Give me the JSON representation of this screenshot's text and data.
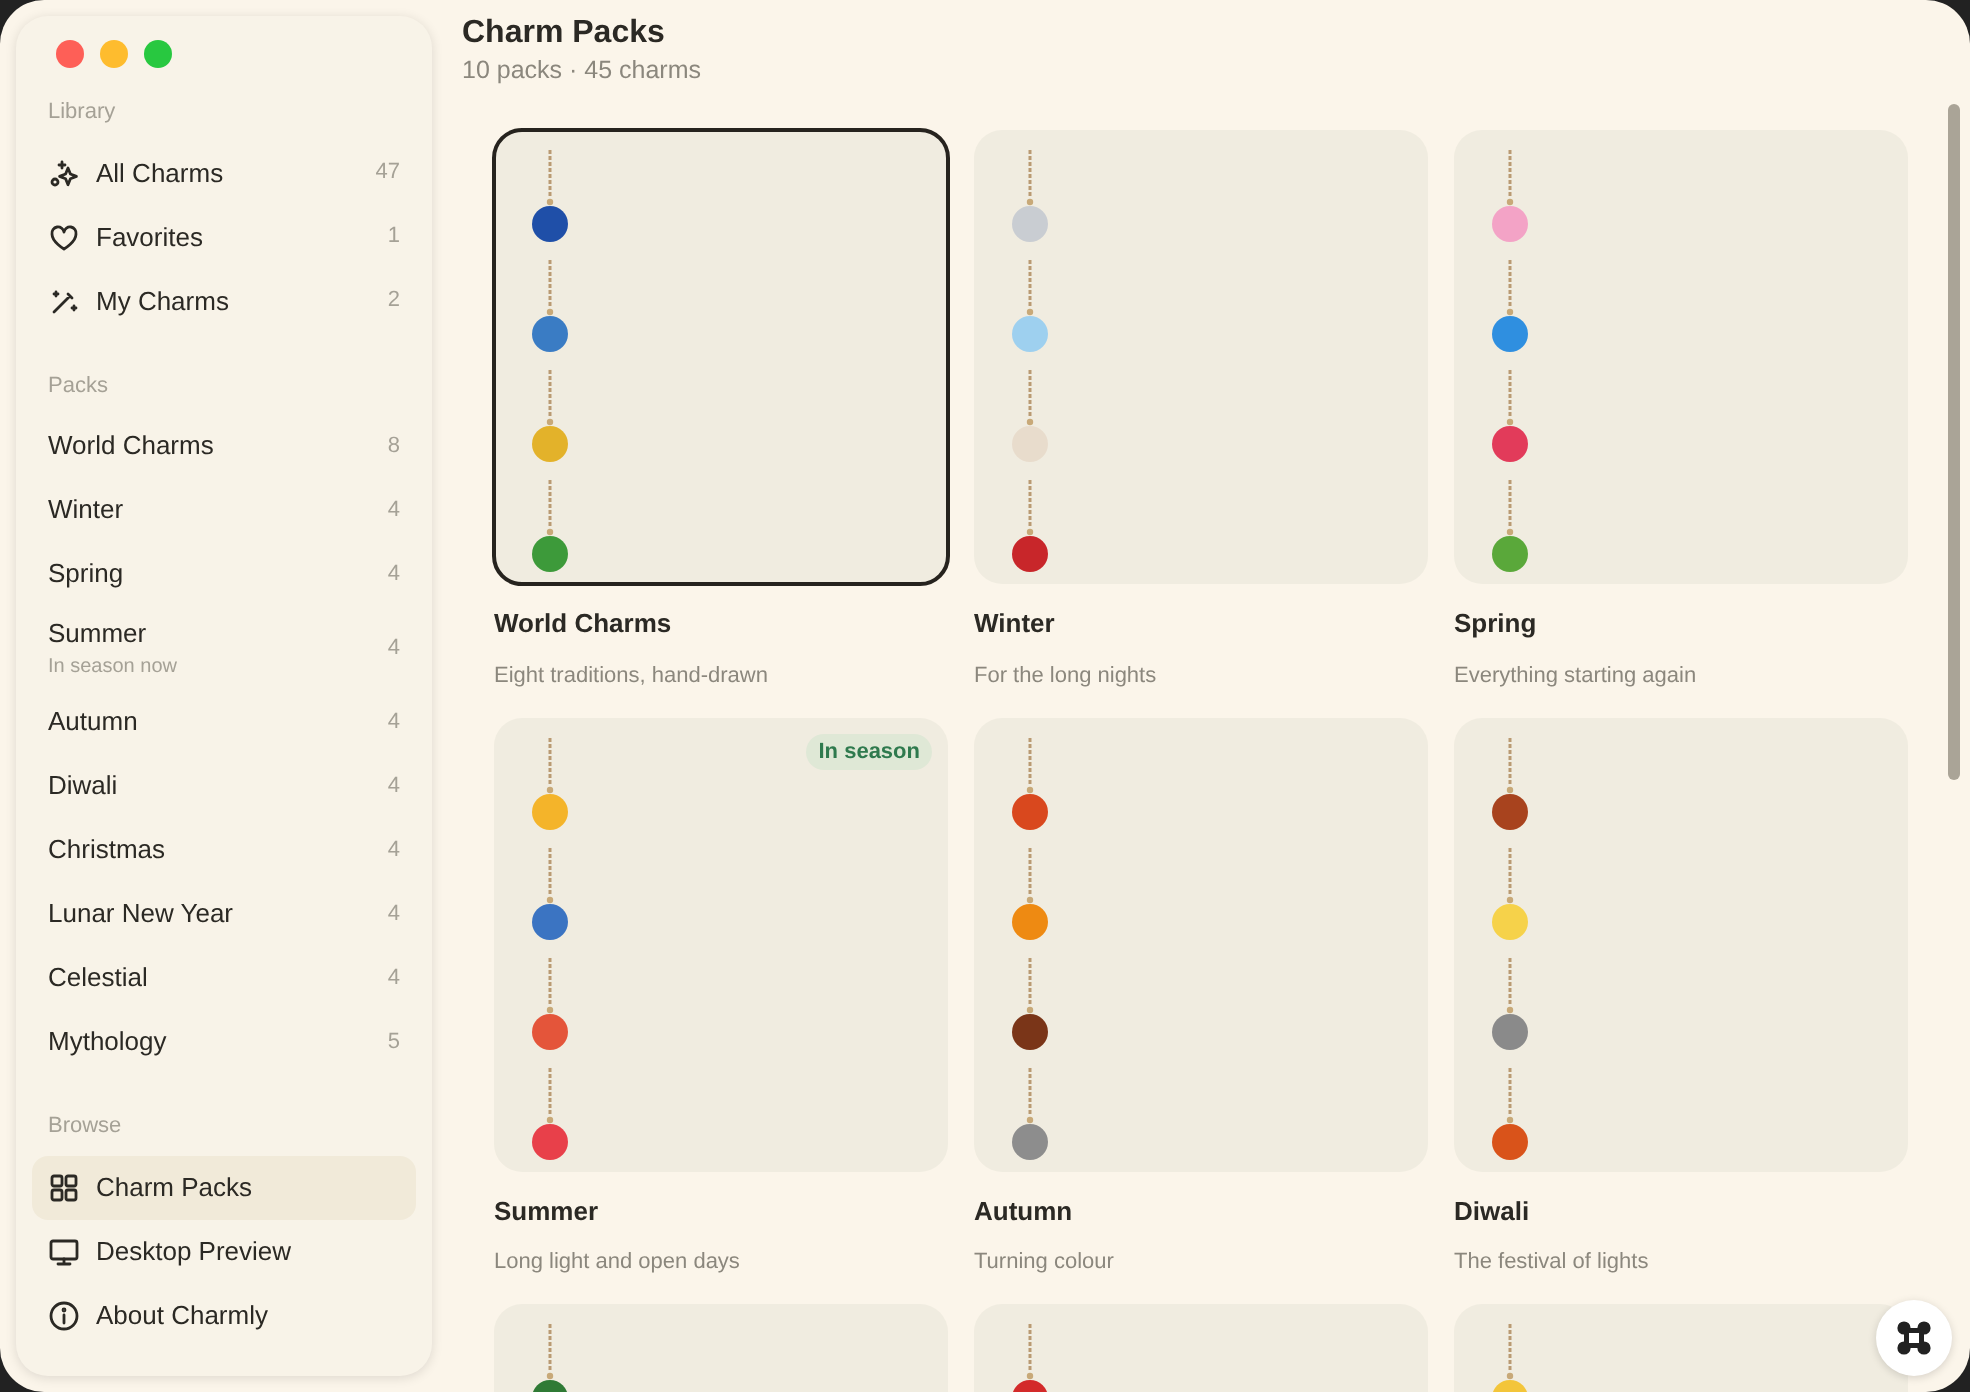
{
  "sidebar": {
    "sections": [
      {
        "heading": "Library",
        "items": [
          {
            "label": "All Charms",
            "count": "47",
            "selected": false
          },
          {
            "label": "Favorites",
            "count": "1",
            "selected": false
          },
          {
            "label": "My Charms",
            "count": "2",
            "selected": false
          }
        ]
      },
      {
        "heading": "Packs",
        "items": [
          {
            "label": "World Charms",
            "count": "8",
            "selected": false
          },
          {
            "label": "Winter",
            "count": "4",
            "selected": false
          },
          {
            "label": "Spring",
            "count": "4",
            "selected": false
          },
          {
            "label": "Summer",
            "subtitle": "In season now",
            "count": "4",
            "selected": false
          },
          {
            "label": "Autumn",
            "count": "4",
            "selected": false
          },
          {
            "label": "Diwali",
            "count": "4",
            "selected": false
          },
          {
            "label": "Christmas",
            "count": "4",
            "selected": false
          },
          {
            "label": "Lunar New Year",
            "count": "4",
            "selected": false
          },
          {
            "label": "Celestial",
            "count": "4",
            "selected": false
          },
          {
            "label": "Mythology",
            "count": "5",
            "selected": false
          }
        ]
      },
      {
        "heading": "Browse",
        "items": [
          {
            "label": "Charm Packs",
            "selected": true
          },
          {
            "label": "Desktop Preview",
            "selected": false
          },
          {
            "label": "About Charmly",
            "selected": false
          }
        ]
      }
    ]
  },
  "header": {
    "title": "Charm Packs",
    "subtitle": "10 packs · 45 charms"
  },
  "packs": [
    {
      "title": "World Charms",
      "description": "Eight traditions, hand-drawn",
      "selected": true,
      "charms": [
        {
          "color": "#1f4fa8"
        },
        {
          "color": "#3a7cc4"
        },
        {
          "color": "#e3b22a"
        },
        {
          "color": "#3d9a3a"
        }
      ]
    },
    {
      "title": "Winter",
      "description": "For the long nights",
      "selected": false,
      "charms": [
        {
          "color": "#c9cdd2"
        },
        {
          "color": "#9ed0ef"
        },
        {
          "color": "#e8dccc"
        },
        {
          "color": "#c8262a"
        }
      ]
    },
    {
      "title": "Spring",
      "description": "Everything starting again",
      "selected": false,
      "charms": [
        {
          "color": "#f3a3c6"
        },
        {
          "color": "#2f8fe0"
        },
        {
          "color": "#e23b5a"
        },
        {
          "color": "#5aa83a"
        }
      ]
    },
    {
      "title": "Summer",
      "description": "Long light and open days",
      "badge": "In season",
      "selected": false,
      "charms": [
        {
          "color": "#f4b42a"
        },
        {
          "color": "#3b74c2"
        },
        {
          "color": "#e4553a"
        },
        {
          "color": "#e8404a"
        }
      ]
    },
    {
      "title": "Autumn",
      "description": "Turning colour",
      "selected": false,
      "charms": [
        {
          "color": "#d9481e"
        },
        {
          "color": "#ee8a12"
        },
        {
          "color": "#7a3518"
        },
        {
          "color": "#8d8d8d"
        }
      ]
    },
    {
      "title": "Diwali",
      "description": "The festival of lights",
      "selected": false,
      "charms": [
        {
          "color": "#a8431e"
        },
        {
          "color": "#f6d24a"
        },
        {
          "color": "#8a8a8a"
        },
        {
          "color": "#d9531a"
        }
      ]
    },
    {
      "selected": false,
      "charms": [
        {
          "color": "#2f7a35"
        }
      ]
    },
    {
      "selected": false,
      "charms": [
        {
          "color": "#d32a2a"
        }
      ]
    },
    {
      "selected": false,
      "charms": [
        {
          "color": "#f3c53a"
        }
      ]
    }
  ]
}
